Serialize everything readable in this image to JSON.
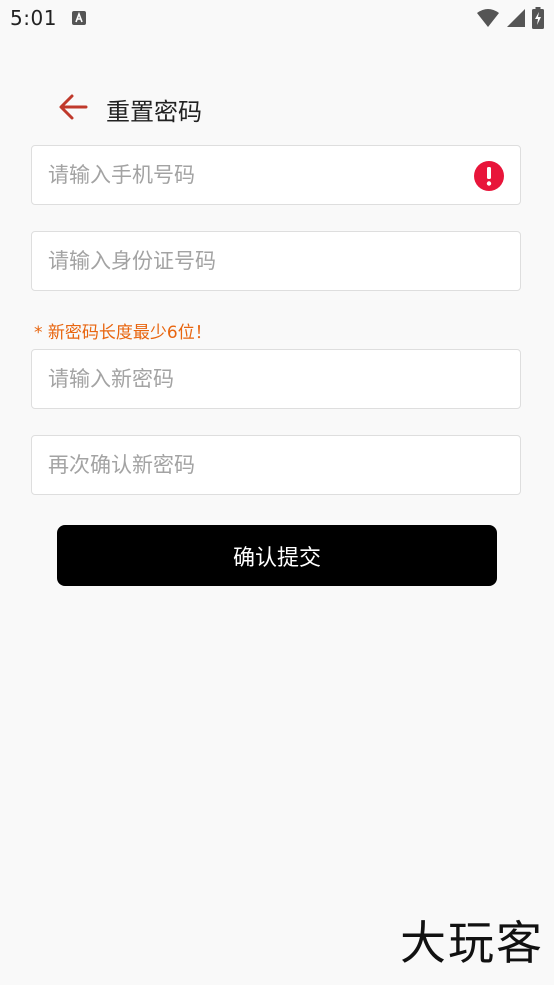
{
  "status_bar": {
    "time": "5:01",
    "icons": [
      "notification-a-icon",
      "wifi-icon",
      "signal-icon",
      "battery-charging-icon"
    ]
  },
  "header": {
    "back_icon": "arrow-left-icon",
    "title": "重置密码",
    "accent_color": "#c0392b"
  },
  "form": {
    "phone": {
      "placeholder": "请输入手机号码",
      "value": "",
      "error_icon": "error-icon"
    },
    "id_card": {
      "placeholder": "请输入身份证号码",
      "value": ""
    },
    "hint": "* 新密码长度最少6位！",
    "new_password": {
      "placeholder": "请输入新密码",
      "value": ""
    },
    "confirm_password": {
      "placeholder": "再次确认新密码",
      "value": ""
    },
    "submit_label": "确认提交"
  },
  "colors": {
    "hint": "#e8650f",
    "error": "#e8153a",
    "button_bg": "#000000"
  },
  "watermark": "大玩客"
}
